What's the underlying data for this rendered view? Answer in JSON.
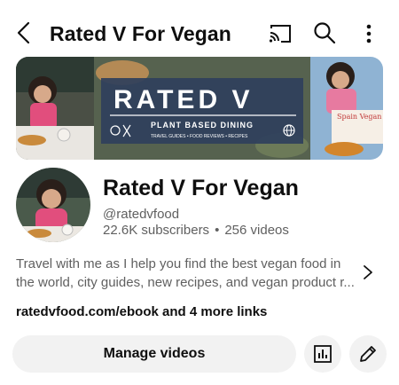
{
  "header": {
    "title": "Rated V For Vegan",
    "icons": [
      "back-arrow-icon",
      "cast-icon",
      "search-icon",
      "more-vert-icon"
    ]
  },
  "banner": {
    "logo_word": "RATED V",
    "tagline": "PLANT BASED DINING",
    "subtagline": "TRAVEL GUIDES • FOOD REVIEWS • RECIPES",
    "side_label": "Spain Vegan Guide!"
  },
  "channel": {
    "name": "Rated V For Vegan",
    "handle": "@ratedvfood",
    "subscribers": "22.6K subscribers",
    "separator": "•",
    "videos": "256 videos"
  },
  "description": {
    "text": "Travel with me as I help you find the best vegan food in the world, city guides, new recipes, and vegan product r..."
  },
  "links": {
    "text": "ratedvfood.com/ebook and 4 more links"
  },
  "actions": {
    "manage_label": "Manage videos",
    "analytics_icon": "bar-chart-icon",
    "edit_icon": "pencil-icon"
  },
  "colors": {
    "background": "#ffffff",
    "text_primary": "#0f0f0f",
    "text_secondary": "#606060",
    "button_bg": "#f2f2f2",
    "banner_blue": "#2f3f5c"
  }
}
